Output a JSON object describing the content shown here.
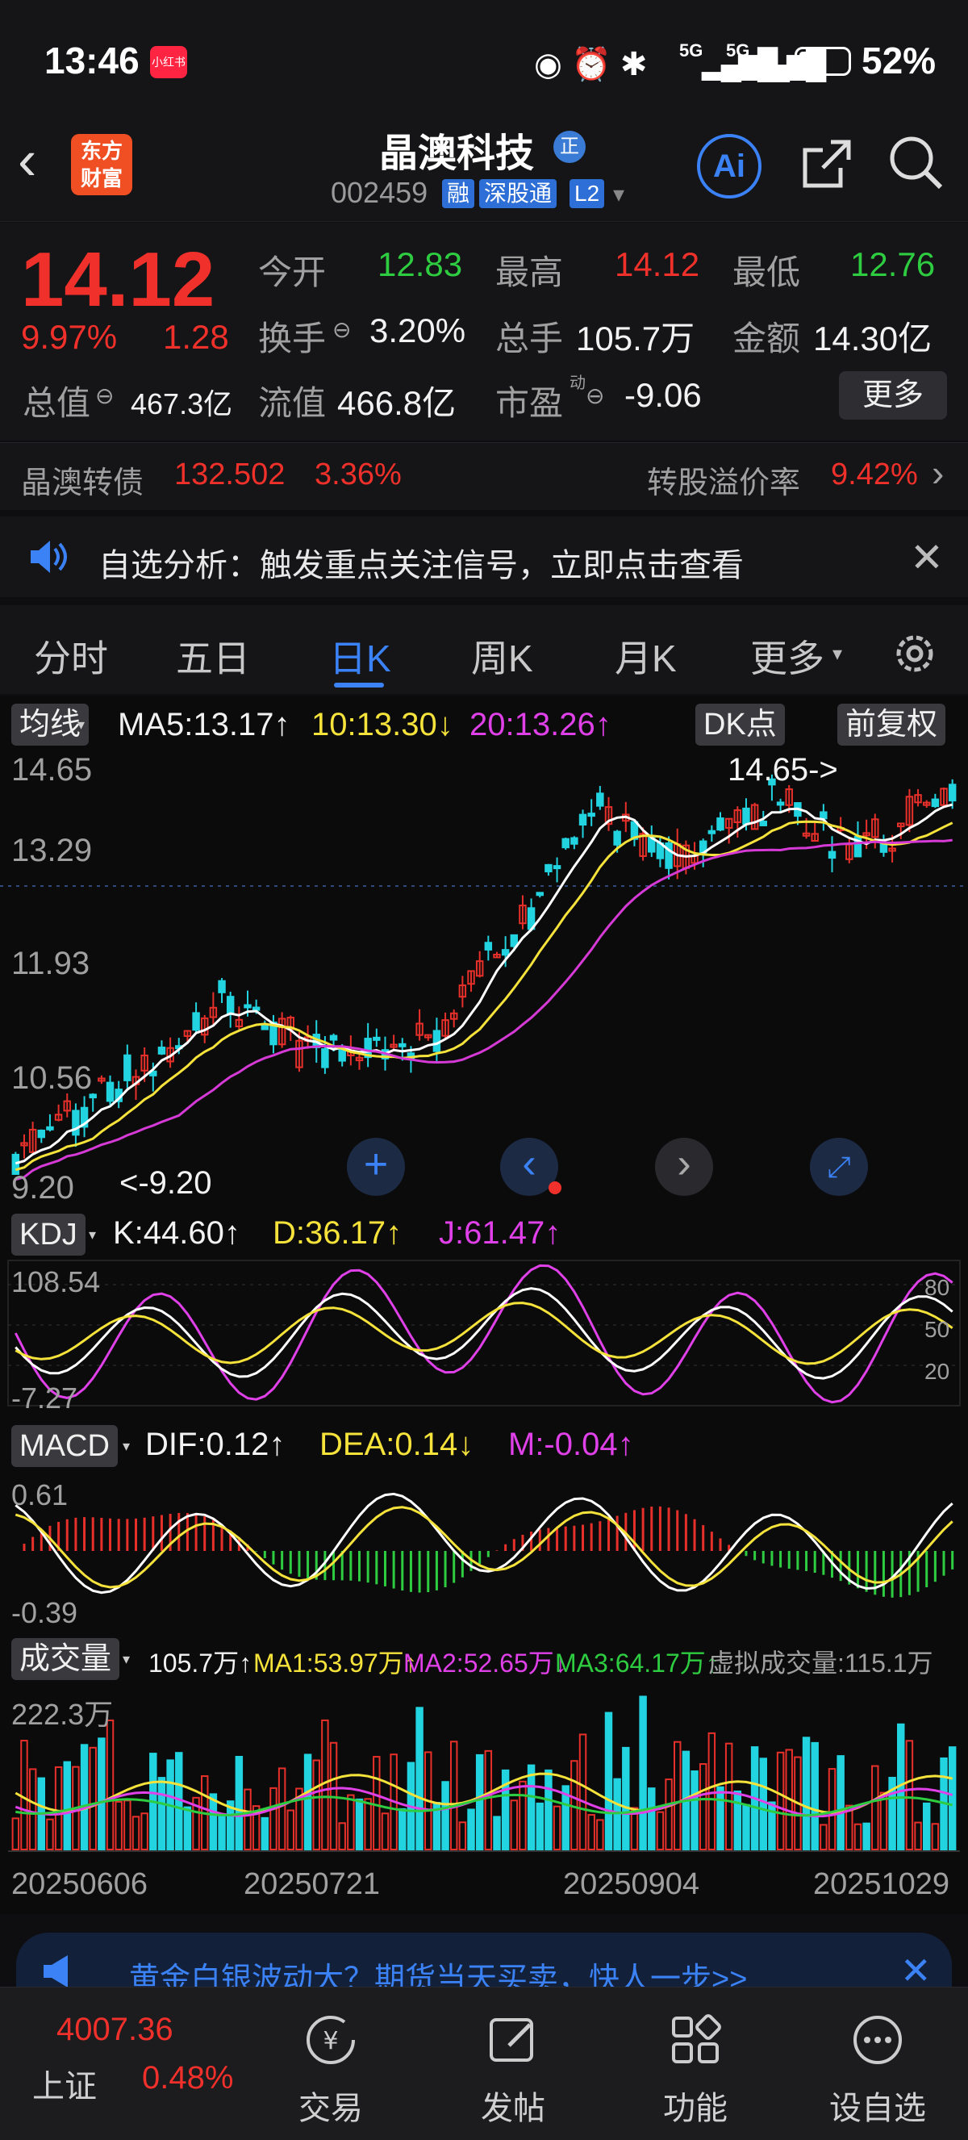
{
  "status_bar": {
    "time": "13:46",
    "app_badge": "小红书",
    "battery": "52%",
    "signal1": "5G",
    "signal2": "5G"
  },
  "header": {
    "title": "晶澳科技",
    "title_badge": "正",
    "code": "002459",
    "tags": [
      "融",
      "深股通",
      "L2"
    ],
    "logo_line1": "东方",
    "logo_line2": "财富",
    "ai_label": "Ai"
  },
  "quote": {
    "price": "14.12",
    "change_pct": "9.97%",
    "change": "1.28",
    "open_label": "今开",
    "open": "12.83",
    "high_label": "最高",
    "high": "14.12",
    "low_label": "最低",
    "low": "12.76",
    "turnover_label": "换手",
    "turnover": "3.20%",
    "volume_label": "总手",
    "volume": "105.7万",
    "amount_label": "金额",
    "amount": "14.30亿",
    "mktcap_label": "总值",
    "mktcap": "467.3亿",
    "float_label": "流值",
    "float": "466.8亿",
    "pe_label": "市盈",
    "pe_sup": "动",
    "pe": "-9.06",
    "more_button": "更多"
  },
  "convertible": {
    "name": "晶澳转债",
    "price": "132.502",
    "pct": "3.36%",
    "premium_label": "转股溢价率",
    "premium": "9.42%"
  },
  "notice": {
    "text": "自选分析：触发重点关注信号，立即点击查看"
  },
  "tabs": [
    "分时",
    "五日",
    "日K",
    "周K",
    "月K",
    "更多"
  ],
  "active_tab": "日K",
  "chart": {
    "ma_selector": "均线",
    "ma5": "MA5:13.17↑",
    "ma10": "10:13.30↓",
    "ma20": "20:13.26↑",
    "dk_button": "DK点",
    "adjust_button": "前复权",
    "price_axis": [
      "14.65",
      "13.29",
      "11.93",
      "10.56",
      "9.20"
    ],
    "high_marker": "14.65->",
    "low_marker": "<-9.20",
    "kdj_selector": "KDJ",
    "k": "K:44.60↑",
    "d": "D:36.17↑",
    "j": "J:61.47↑",
    "kdj_axis": [
      "108.54",
      "-7.27"
    ],
    "kdj_levels": [
      "80",
      "50",
      "20"
    ],
    "macd_selector": "MACD",
    "dif": "DIF:0.12↑",
    "dea": "DEA:0.14↓",
    "m": "M:-0.04↑",
    "macd_axis": [
      "0.61",
      "-0.39"
    ],
    "vol_selector": "成交量",
    "vol": "105.7万↑",
    "vma1": "MA1:53.97万↑",
    "vma2": "MA2:52.65万↓",
    "vma3": "MA3:64.17万↑",
    "virtual_vol": "虚拟成交量:115.1万",
    "vol_axis": "222.3万",
    "dates": [
      "20250606",
      "20250721",
      "20250904",
      "20251029"
    ],
    "colors": {
      "up": "#e8302a",
      "down": "#22d3e0",
      "ma5": "#ffffff",
      "ma10": "#f5e23a",
      "ma20": "#d63ad6",
      "vma3": "#2ecc40"
    }
  },
  "ad": {
    "text": "黄金白银波动大？期货当天买卖，快人一步>>"
  },
  "bottom_nav": {
    "index_value": "4007.36",
    "index_name": "上证",
    "index_pct": "0.48%",
    "items": [
      "交易",
      "发帖",
      "功能",
      "设自选"
    ]
  }
}
